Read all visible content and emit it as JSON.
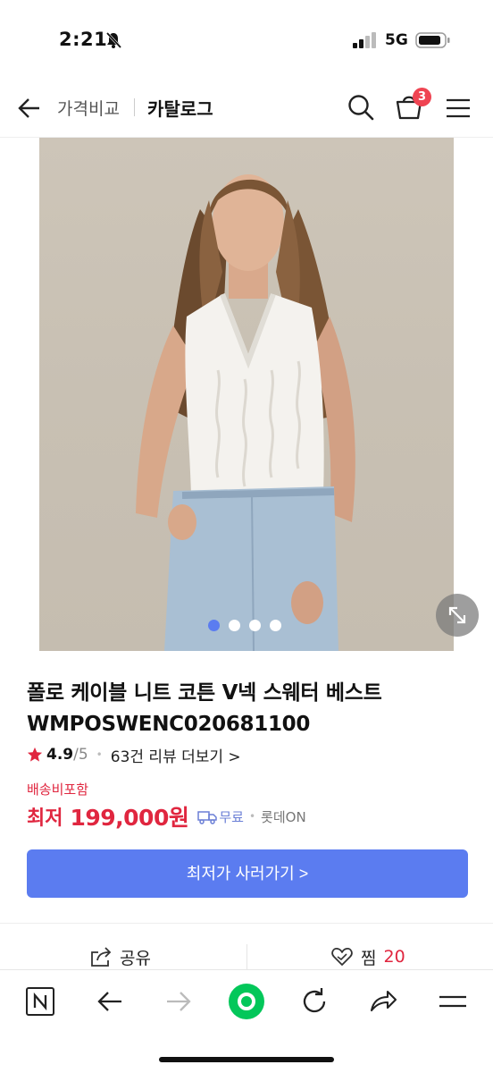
{
  "status_bar": {
    "time": "2:21",
    "network": "5G"
  },
  "header": {
    "compare_label": "가격비교",
    "catalog_title": "카탈로그",
    "cart_count": "3"
  },
  "gallery": {
    "image_count": 4,
    "active_index": 0
  },
  "product": {
    "title": "폴로 케이블 니트 코튼 V넥 스웨터 베스트 WMPOSWENC020681100",
    "rating": "4.9",
    "rating_max": "/5",
    "review_link": "63건 리뷰 더보기 >",
    "shipping_note": "배송비포함",
    "price_prefix": "최저",
    "price": "199,000원",
    "delivery": "무료",
    "seller": "롯데ON",
    "cta_label": "최저가 사러가기 >"
  },
  "actions": {
    "share_label": "공유",
    "wish_label": "찜",
    "wish_count": "20"
  },
  "colors": {
    "accent_blue": "#5b7cf0",
    "price_red": "#e0263f",
    "badge_red": "#ef4452"
  },
  "browser_toolbar": {
    "icons": [
      "naver-home-icon",
      "back-arrow-icon",
      "forward-arrow-icon",
      "green-home-icon",
      "refresh-icon",
      "share-arrow-icon",
      "menu-lines-icon"
    ]
  }
}
